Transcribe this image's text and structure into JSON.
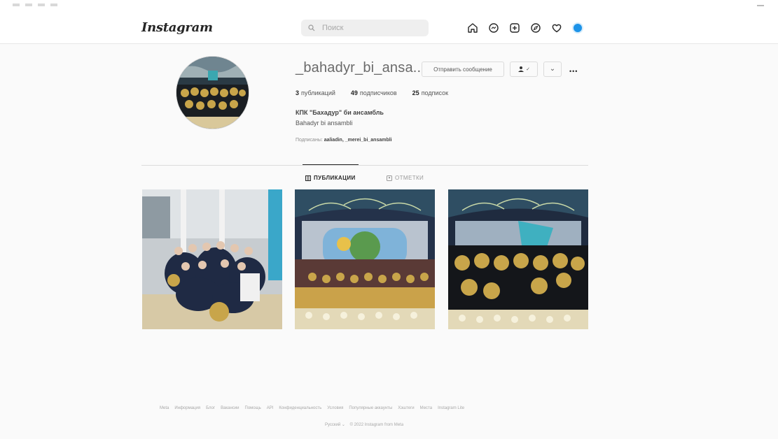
{
  "app": {
    "logo": "Instagram"
  },
  "search": {
    "placeholder": "Поиск"
  },
  "profile": {
    "username": "_bahadyr_bi_ansa...",
    "buttons": {
      "message": "Отправить сообщение",
      "follow_label": "✓",
      "chevron": "⌄",
      "more": "•••"
    },
    "stats": {
      "posts_count": "3",
      "posts_label": "публикаций",
      "followers_count": "49",
      "followers_label": "подписчиков",
      "following_count": "25",
      "following_label": "подписок"
    },
    "full_name": "КПК \"Бахадур\" би ансамбль",
    "bio": "Bahadyr bi ansambli",
    "followed_by": {
      "prefix": "Подписаны:",
      "names": "aaliadin, _merei_bi_ansambli"
    }
  },
  "tabs": [
    {
      "label": "ПУБЛИКАЦИИ",
      "icon": "grid-icon",
      "active": true
    },
    {
      "label": "ОТМЕТКИ",
      "icon": "tag-icon",
      "active": false
    }
  ],
  "posts": [
    {
      "icon": "photo-group-hall"
    },
    {
      "icon": "photo-stage-wide"
    },
    {
      "icon": "photo-stage-flag"
    }
  ],
  "footer": {
    "links": [
      "Meta",
      "Информация",
      "Блог",
      "Вакансии",
      "Помощь",
      "API",
      "Конфиденциальность",
      "Условия",
      "Популярные аккаунты",
      "Хэштеги",
      "Места",
      "Instagram Lite"
    ],
    "language": "Русский ⌄",
    "copyright": "© 2022 Instagram from Meta"
  },
  "colors": {
    "accent": "#1d93e8",
    "text": "#262626",
    "muted": "#8e8e8e",
    "background": "#fafafa"
  }
}
